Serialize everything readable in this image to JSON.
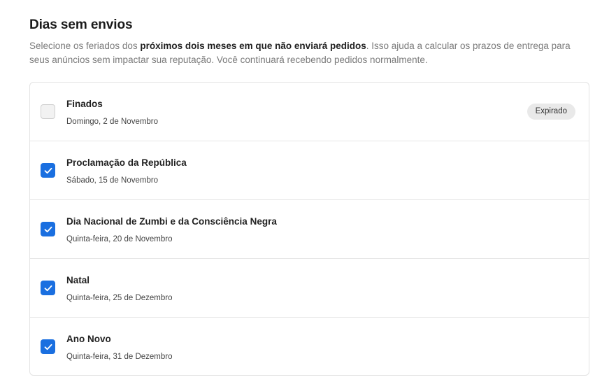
{
  "section": {
    "title": "Dias sem envios",
    "description_part1": "Selecione os feriados dos ",
    "description_bold": "próximos dois meses em que não enviará pedidos",
    "description_part2": ". Isso ajuda a calcular os prazos de entrega para seus anúncios sem impactar sua reputação. Você continuará recebendo pedidos normalmente."
  },
  "holidays": [
    {
      "name": "Finados",
      "date": "Domingo, 2 de Novembro",
      "checked": false,
      "badge": "Expirado"
    },
    {
      "name": "Proclamação da República",
      "date": "Sábado, 15 de Novembro",
      "checked": true
    },
    {
      "name": "Dia Nacional de Zumbi e da Consciência Negra",
      "date": "Quinta-feira, 20 de Novembro",
      "checked": true
    },
    {
      "name": "Natal",
      "date": "Quinta-feira, 25 de Dezembro",
      "checked": true
    },
    {
      "name": "Ano Novo",
      "date": "Quinta-feira, 31 de Dezembro",
      "checked": true
    }
  ],
  "colors": {
    "accent": "#1a6fe0",
    "muted_text": "#7a7a7a",
    "badge_bg": "#e9e9e9"
  },
  "icons": {
    "checked": "checkmark-icon"
  }
}
